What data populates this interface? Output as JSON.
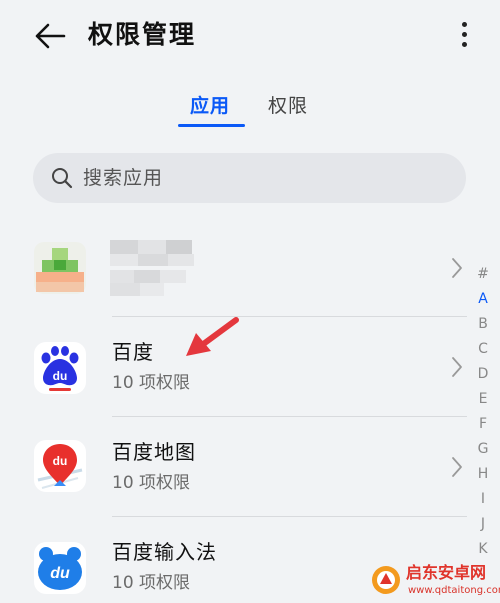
{
  "header": {
    "title": "权限管理",
    "back_icon": "arrow-left-icon",
    "more_icon": "more-vertical-icon"
  },
  "tabs": [
    {
      "label": "应用",
      "active": true
    },
    {
      "label": "权限",
      "active": false
    }
  ],
  "search": {
    "placeholder": "搜索应用",
    "icon": "search-icon"
  },
  "apps": [
    {
      "name": "",
      "subtitle": "",
      "icon": "blurred-app-icon",
      "blurred": true
    },
    {
      "name": "百度",
      "subtitle": "10 项权限",
      "icon": "baidu-icon"
    },
    {
      "name": "百度地图",
      "subtitle": "10 项权限",
      "icon": "baidu-map-icon"
    },
    {
      "name": "百度输入法",
      "subtitle": "10 项权限",
      "icon": "baidu-input-icon"
    }
  ],
  "index_bar": {
    "letters": [
      "#",
      "A",
      "B",
      "C",
      "D",
      "E",
      "F",
      "G",
      "H",
      "I",
      "J",
      "K"
    ],
    "active": "A"
  },
  "watermark": {
    "title": "启东安卓网",
    "url": "www.qdtaitong.com"
  },
  "colors": {
    "accent": "#0a59f7",
    "background": "#f1f3f5",
    "annotation": "#e4373d"
  }
}
